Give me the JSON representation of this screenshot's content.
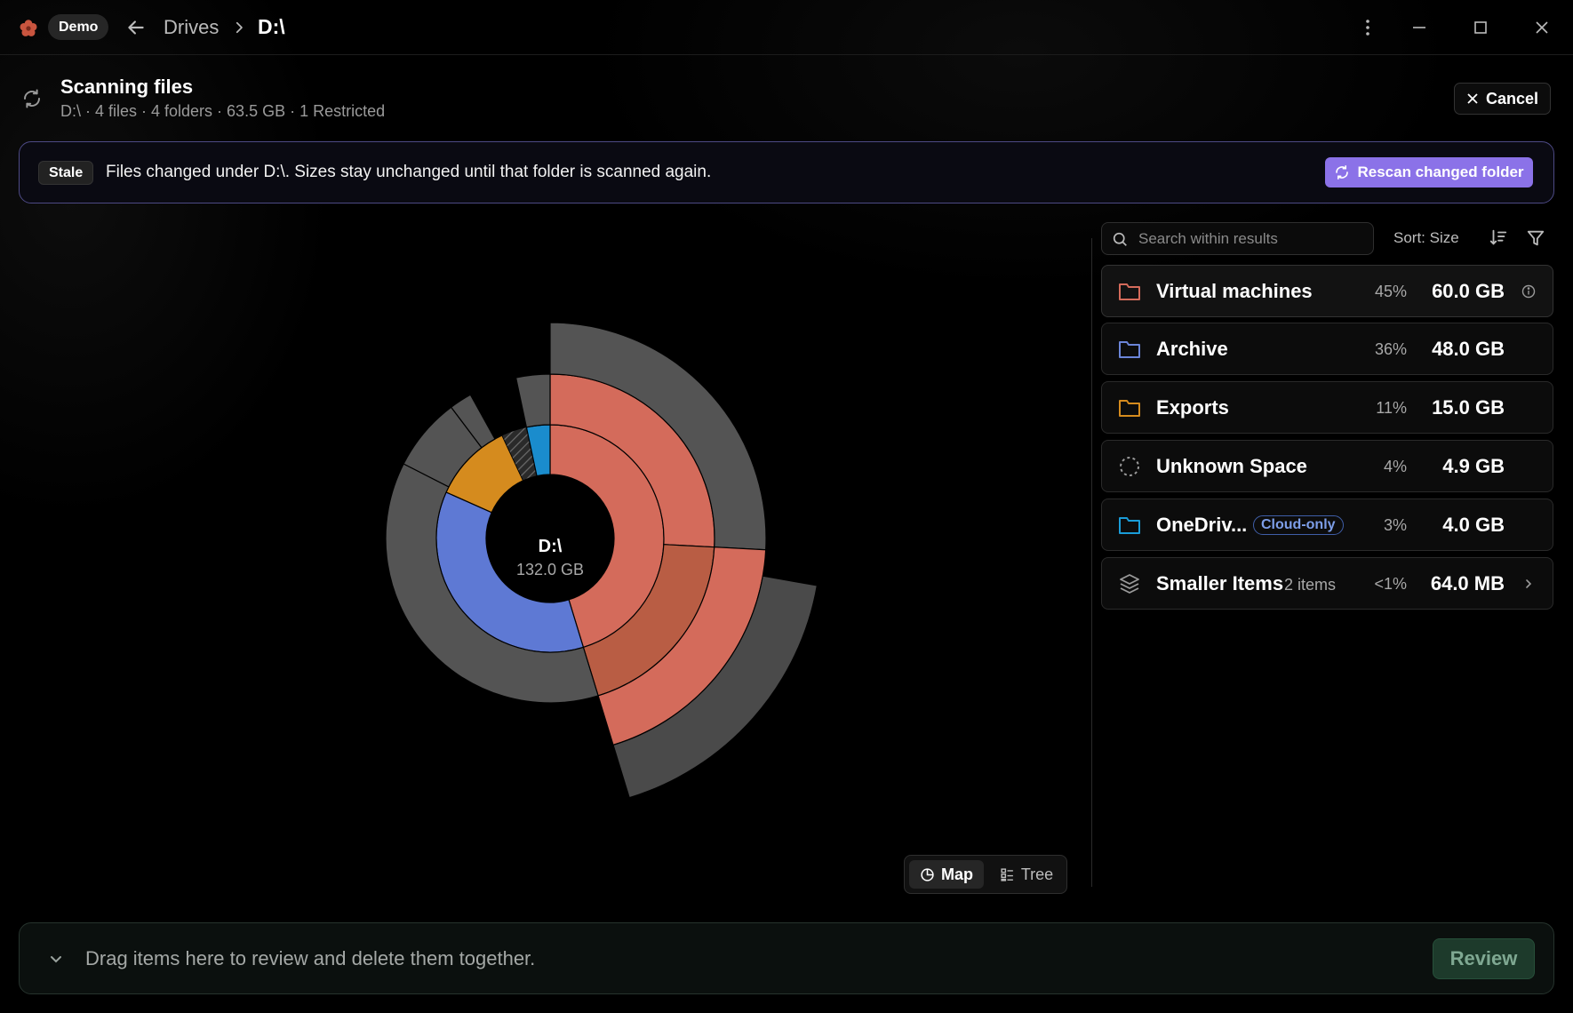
{
  "titlebar": {
    "app_name": "Demo",
    "breadcrumb": [
      "Drives",
      "D:\\"
    ]
  },
  "scan": {
    "title": "Scanning files",
    "subtitle": "D:\\ · 4 files · 4 folders · 63.5 GB · 1 Restricted",
    "cancel_label": "Cancel"
  },
  "banner": {
    "badge": "Stale",
    "message": "Files changed under D:\\. Sizes stay unchanged until that folder is scanned again.",
    "action_label": "Rescan changed folder"
  },
  "chart": {
    "center_title": "D:\\",
    "center_value": "132.0 GB"
  },
  "chart_data": {
    "type": "sunburst",
    "center": "D:\\",
    "total": "132.0 GB",
    "series": [
      {
        "name": "Virtual machines",
        "value_gb": 60.0,
        "color": "#d46b5b"
      },
      {
        "name": "Archive",
        "value_gb": 48.0,
        "color": "#5e79d4"
      },
      {
        "name": "Exports",
        "value_gb": 15.0,
        "color": "#d58b1e"
      },
      {
        "name": "Unknown Space",
        "value_gb": 4.9,
        "color": "#555555"
      },
      {
        "name": "OneDrive",
        "value_gb": 4.0,
        "color": "#1a8ccd"
      }
    ]
  },
  "view_toggle": {
    "map_label": "Map",
    "tree_label": "Tree",
    "active": "Map"
  },
  "panel": {
    "search_placeholder": "Search within results",
    "sort_label": "Sort: Size",
    "items": [
      {
        "name": "Virtual machines",
        "pct": "45%",
        "size": "60.0 GB",
        "icon": "folder-icon",
        "color": "#d46b5b"
      },
      {
        "name": "Archive",
        "pct": "36%",
        "size": "48.0 GB",
        "icon": "folder-icon",
        "color": "#6b85d8"
      },
      {
        "name": "Exports",
        "pct": "11%",
        "size": "15.0 GB",
        "icon": "folder-icon",
        "color": "#d58b1e"
      },
      {
        "name": "Unknown Space",
        "pct": "4%",
        "size": "4.9 GB",
        "icon": "dashed-circle-icon",
        "color": "#9a9a9a"
      },
      {
        "name": "OneDriv...",
        "badge": "Cloud-only",
        "pct": "3%",
        "size": "4.0 GB",
        "icon": "folder-icon",
        "color": "#1a9cd8"
      },
      {
        "name": "Smaller Items",
        "count": "2 items",
        "pct": "<1%",
        "size": "64.0 MB",
        "icon": "stack-icon",
        "color": "#9a9a9a"
      }
    ]
  },
  "review": {
    "message": "Drag items here to review and delete them together.",
    "button_label": "Review"
  }
}
